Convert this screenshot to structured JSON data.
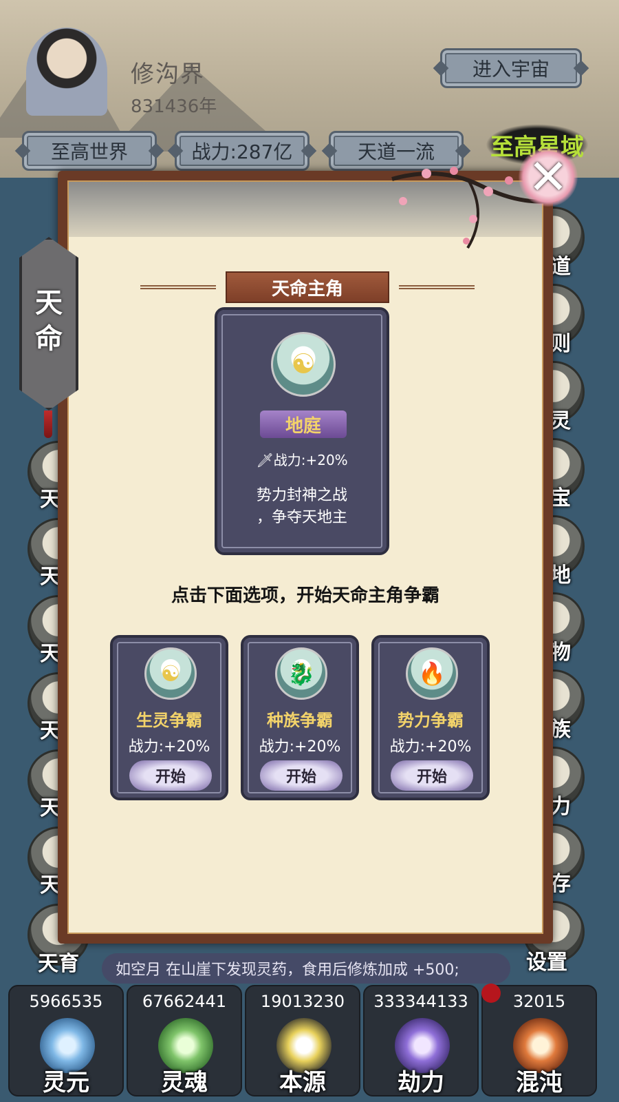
{
  "player": {
    "name": "修沟界",
    "years": "831436年",
    "enter_button": "进入宇宙",
    "stats": [
      "至高世界",
      "战力:287亿",
      "天道一流"
    ],
    "region": "至高星域"
  },
  "side_tab": {
    "label_line1": "天",
    "label_line2": "命"
  },
  "left_menu_labels": [
    "天",
    "天",
    "天",
    "天",
    "天",
    "天",
    "天育"
  ],
  "right_menu_labels": [
    "道",
    "则",
    "灵",
    "宝",
    "地",
    "物",
    "族",
    "力",
    "存",
    "设置"
  ],
  "panel": {
    "title": "天命主角",
    "main_card": {
      "name": "地庭",
      "power": "战力:+20%",
      "desc_line1": "势力封神之战",
      "desc_line2": "，争夺天地主"
    },
    "instruction": "点击下面选项，开始天命主角争霸",
    "options": [
      {
        "name": "生灵争霸",
        "power": "战力:+20%",
        "button": "开始",
        "icon": "immortal-portrait-icon"
      },
      {
        "name": "种族争霸",
        "power": "战力:+20%",
        "button": "开始",
        "icon": "dragon-head-icon"
      },
      {
        "name": "势力争霸",
        "power": "战力:+20%",
        "button": "开始",
        "icon": "flame-icon"
      }
    ]
  },
  "ticker": "如空月 在山崖下发现灵药，食用后修炼加成 +500;",
  "resources": [
    {
      "value": "5966535",
      "label": "灵元",
      "color": "#7fb8e6"
    },
    {
      "value": "67662441",
      "label": "灵魂",
      "color": "#7fc46a"
    },
    {
      "value": "19013230",
      "label": "本源",
      "color": "#e8d15b"
    },
    {
      "value": "333344133",
      "label": "劫力",
      "color": "#8f6fd8"
    },
    {
      "value": "32015",
      "label": "混沌",
      "color": "#e07a3c"
    }
  ]
}
